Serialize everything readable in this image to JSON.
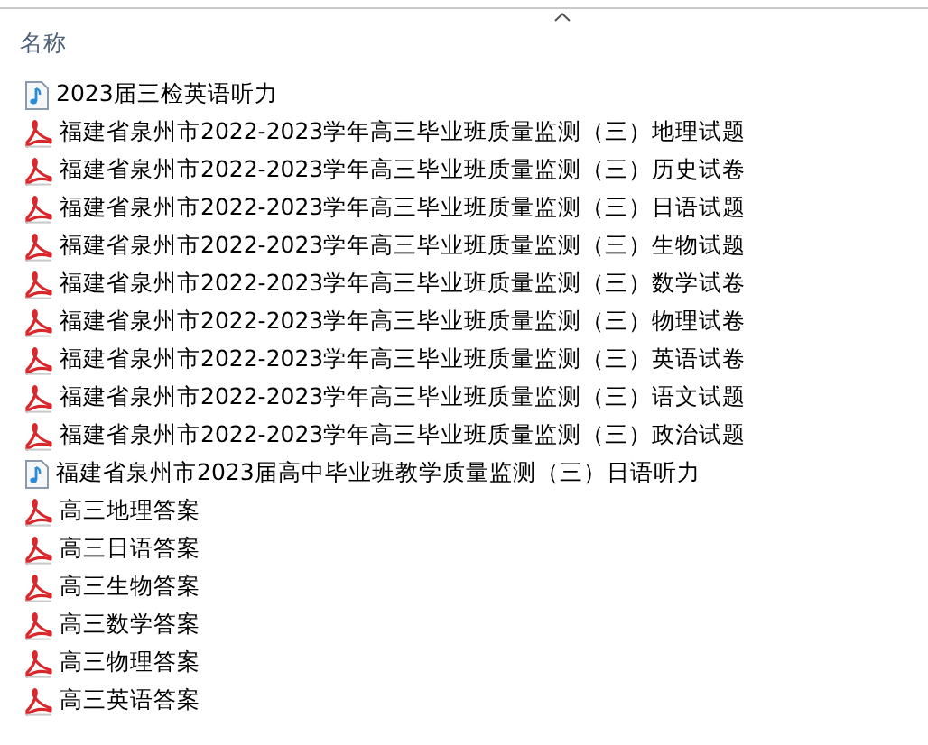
{
  "columns": [
    {
      "label": "名称"
    }
  ],
  "files": [
    {
      "kind": "audio",
      "name": "2023届三检英语听力"
    },
    {
      "kind": "pdf",
      "name": "福建省泉州市2022-2023学年高三毕业班质量监测（三）地理试题"
    },
    {
      "kind": "pdf",
      "name": "福建省泉州市2022-2023学年高三毕业班质量监测（三）历史试卷"
    },
    {
      "kind": "pdf",
      "name": "福建省泉州市2022-2023学年高三毕业班质量监测（三）日语试题"
    },
    {
      "kind": "pdf",
      "name": "福建省泉州市2022-2023学年高三毕业班质量监测（三）生物试题"
    },
    {
      "kind": "pdf",
      "name": "福建省泉州市2022-2023学年高三毕业班质量监测（三）数学试卷"
    },
    {
      "kind": "pdf",
      "name": "福建省泉州市2022-2023学年高三毕业班质量监测（三）物理试卷"
    },
    {
      "kind": "pdf",
      "name": "福建省泉州市2022-2023学年高三毕业班质量监测（三）英语试卷"
    },
    {
      "kind": "pdf",
      "name": "福建省泉州市2022-2023学年高三毕业班质量监测（三）语文试题"
    },
    {
      "kind": "pdf",
      "name": "福建省泉州市2022-2023学年高三毕业班质量监测（三）政治试题"
    },
    {
      "kind": "audio",
      "name": "福建省泉州市2023届高中毕业班教学质量监测（三）日语听力"
    },
    {
      "kind": "pdf",
      "name": "高三地理答案"
    },
    {
      "kind": "pdf",
      "name": "高三日语答案"
    },
    {
      "kind": "pdf",
      "name": "高三生物答案"
    },
    {
      "kind": "pdf",
      "name": "高三数学答案"
    },
    {
      "kind": "pdf",
      "name": "高三物理答案"
    },
    {
      "kind": "pdf",
      "name": "高三英语答案"
    }
  ]
}
